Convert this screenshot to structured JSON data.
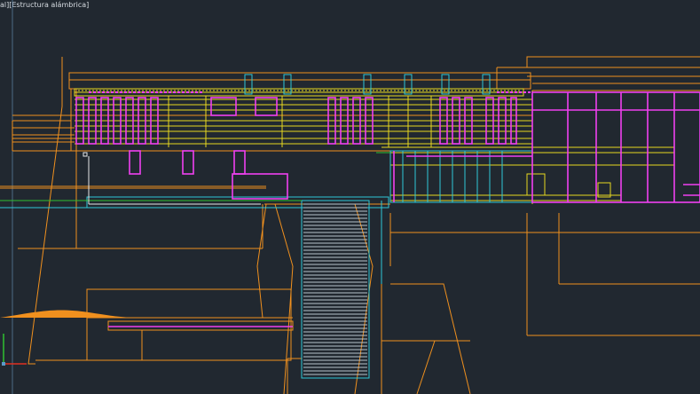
{
  "viewport": {
    "label": "al][Estructura alámbrica]",
    "background": "#212830"
  },
  "colors": {
    "orange": "#f0901e",
    "yellow": "#e8d820",
    "magenta": "#f040f0",
    "cyan": "#30c8d8",
    "white": "#e8e8e8",
    "green": "#30c030",
    "red": "#e03020",
    "crosshair": "#5a9ac8"
  },
  "ucs_icon": "ucs-axis-icon"
}
